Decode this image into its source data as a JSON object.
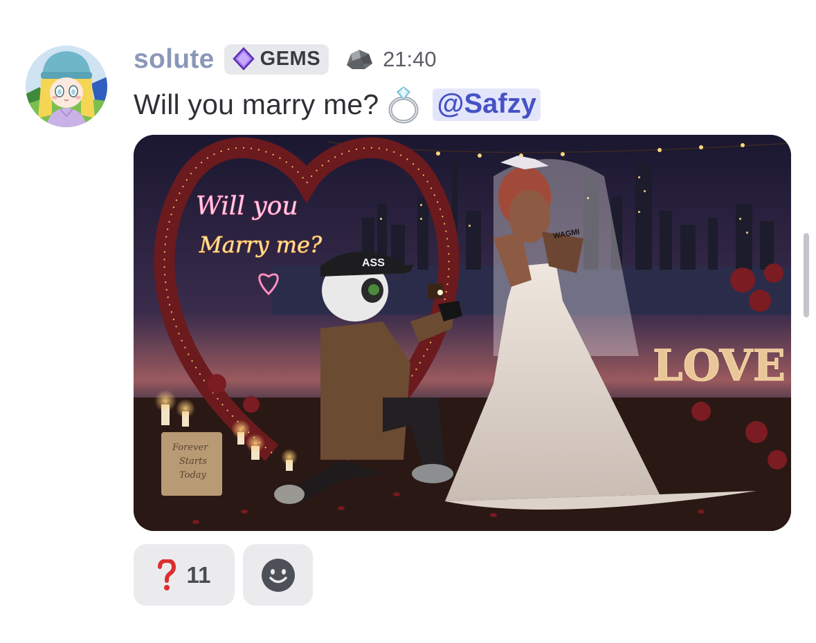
{
  "message": {
    "username": "solute",
    "tag": {
      "label": "GEMS",
      "icon": "purple-gem-icon",
      "color": "#9b6cf0"
    },
    "badge_icon": "rock-icon",
    "timestamp": "21:40",
    "text": "Will you marry me?",
    "emoji_icon": "ring-icon",
    "mention": "@Safzy"
  },
  "attachment": {
    "type": "image",
    "neon_line1": "Will you",
    "neon_line2": "Marry me?",
    "cap_text": "ASS",
    "tattoo_text": "WAGMI",
    "sign_text": "LOVE",
    "board_line1": "Forever",
    "board_line2": "Starts",
    "board_line3": "Today"
  },
  "reactions": [
    {
      "emoji": "red-question-mark-icon",
      "count": "11"
    },
    {
      "emoji": "add-reaction-smiley-icon"
    }
  ],
  "colors": {
    "username": "#8a97b8",
    "mention_text": "#4752c4",
    "mention_bg": "#e3e6fb",
    "reaction_bg": "#ebebee"
  }
}
